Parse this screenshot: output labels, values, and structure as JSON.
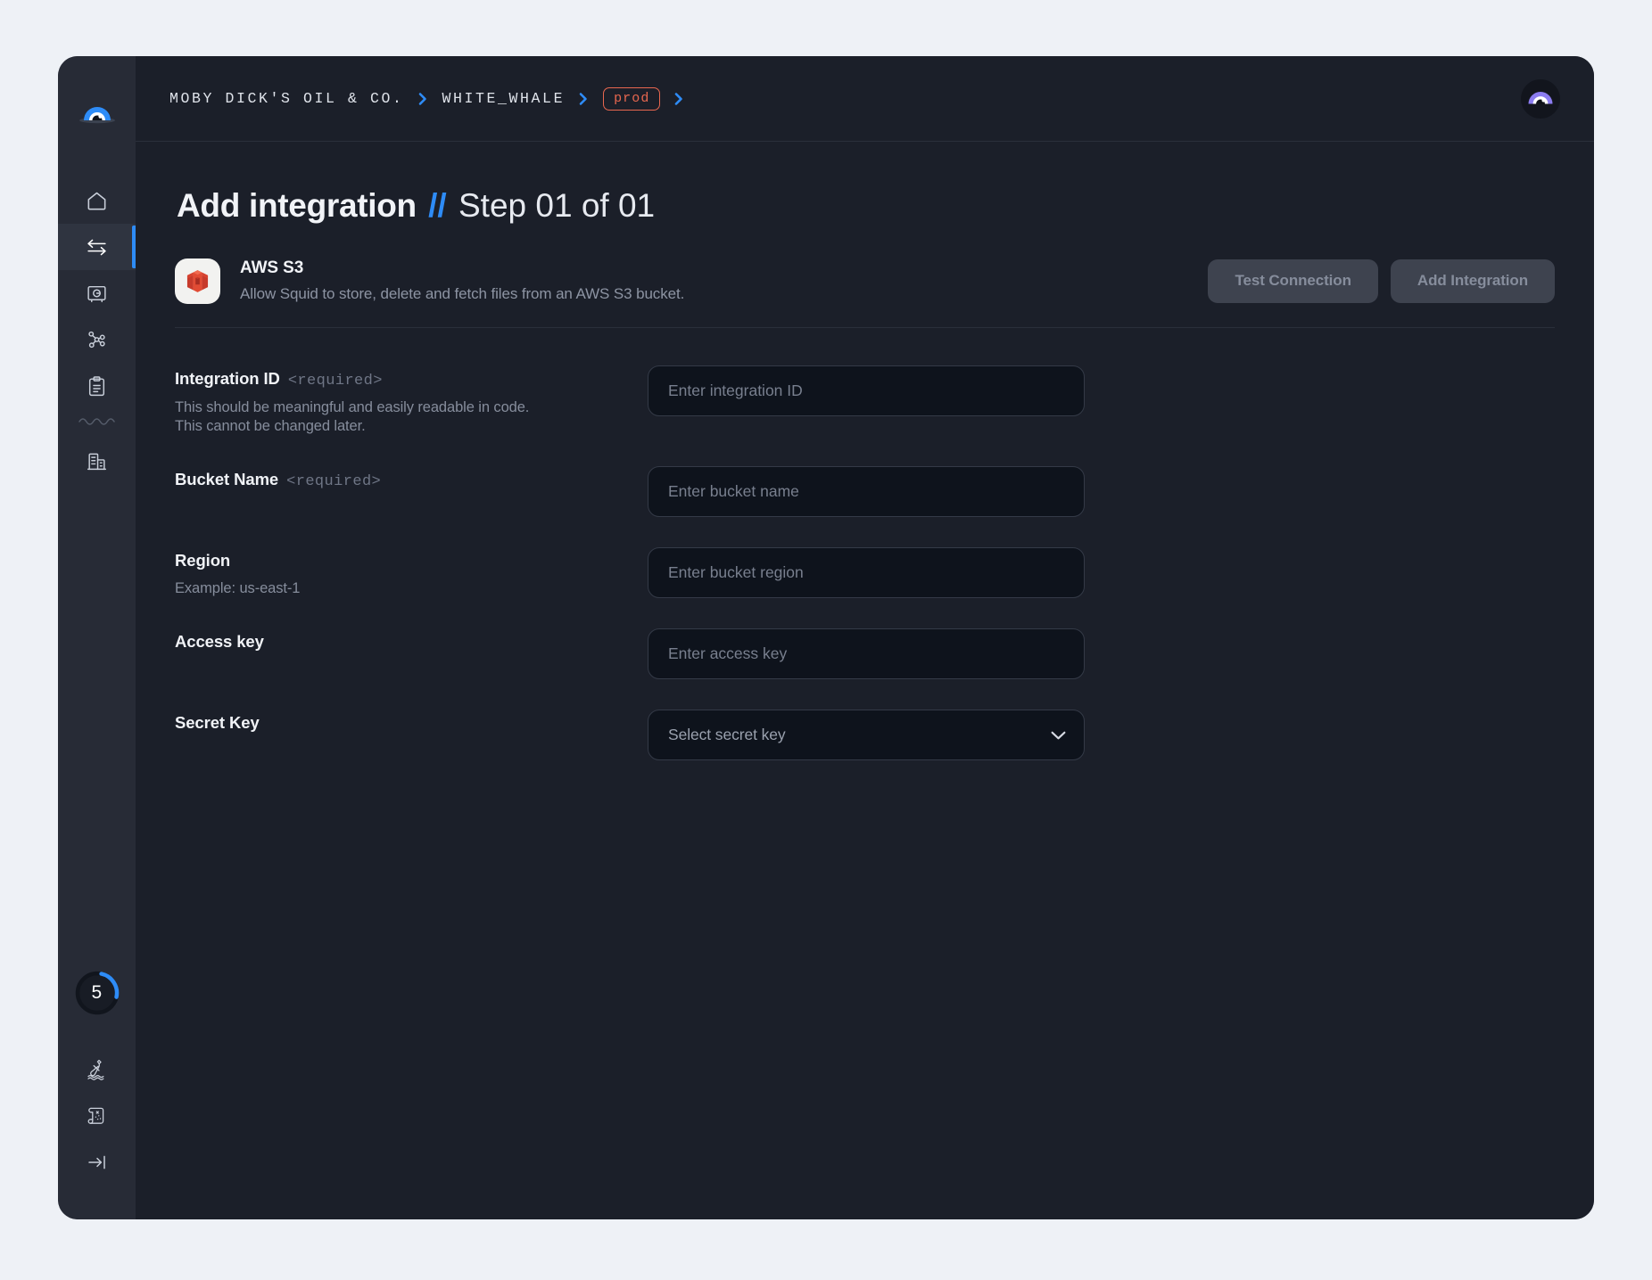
{
  "window": {
    "background_color": "#eef1f6",
    "surface_color": "#1b1f29",
    "sidebar_color": "#272b36",
    "accent_color": "#2e8cf7",
    "env_color": "#e8674f"
  },
  "sidebar": {
    "logo": {
      "name": "squid-eye-logo"
    },
    "items": [
      {
        "icon": "home-icon",
        "name": "sidebar-item-home",
        "active": false
      },
      {
        "icon": "integrations-arrows-icon",
        "name": "sidebar-item-integrations",
        "active": true
      },
      {
        "icon": "vault-safe-icon",
        "name": "sidebar-item-secrets",
        "active": false
      },
      {
        "icon": "network-graph-icon",
        "name": "sidebar-item-schema",
        "active": false
      },
      {
        "icon": "clipboard-icon",
        "name": "sidebar-item-logs",
        "active": false
      },
      {
        "icon": "wave-divider-icon",
        "name": "sidebar-divider",
        "active": false
      },
      {
        "icon": "building-icon",
        "name": "sidebar-item-organization",
        "active": false
      }
    ],
    "progress_badge": {
      "value": "5",
      "percent": 25,
      "name": "onboarding-progress"
    },
    "bottom_items": [
      {
        "icon": "message-in-bottle-icon",
        "name": "sidebar-item-feedback"
      },
      {
        "icon": "treasure-map-icon",
        "name": "sidebar-item-docs"
      },
      {
        "icon": "collapse-sidebar-icon",
        "name": "sidebar-collapse-button"
      }
    ]
  },
  "topbar": {
    "breadcrumb": [
      {
        "type": "text",
        "label": "MOBY DICK'S OIL & CO."
      },
      {
        "type": "separator",
        "label": "chevron-right-icon"
      },
      {
        "type": "text",
        "label": "WHITE_WHALE"
      },
      {
        "type": "separator",
        "label": "chevron-right-icon"
      },
      {
        "type": "badge",
        "label": "prod"
      },
      {
        "type": "separator",
        "label": "chevron-right-icon"
      }
    ],
    "avatar": {
      "name": "user-avatar"
    }
  },
  "page": {
    "title_strong": "Add integration",
    "title_separator": "//",
    "title_step": "Step 01 of 01"
  },
  "integration": {
    "logo_name": "aws-s3-logo",
    "name": "AWS S3",
    "description": "Allow Squid to store, delete and fetch files from an AWS S3 bucket.",
    "actions": [
      {
        "label": "Test Connection",
        "name": "test-connection-button"
      },
      {
        "label": "Add Integration",
        "name": "add-integration-button"
      }
    ]
  },
  "form": {
    "fields": [
      {
        "label": "Integration ID",
        "required_tag": "<required>",
        "help": "This should be meaningful and easily readable in code.\nThis cannot be changed later.",
        "control": "text",
        "placeholder": "Enter integration ID",
        "value": "",
        "name_label": "integration-id-label",
        "name_input": "integration-id-input"
      },
      {
        "label": "Bucket Name",
        "required_tag": "<required>",
        "help": "",
        "control": "text",
        "placeholder": "Enter bucket name",
        "value": "",
        "name_label": "bucket-name-label",
        "name_input": "bucket-name-input"
      },
      {
        "label": "Region",
        "required_tag": "",
        "help": "Example: us-east-1",
        "control": "text",
        "placeholder": "Enter bucket region",
        "value": "",
        "name_label": "region-label",
        "name_input": "region-input"
      },
      {
        "label": "Access key",
        "required_tag": "",
        "help": "",
        "control": "text",
        "placeholder": "Enter access key",
        "value": "",
        "name_label": "access-key-label",
        "name_input": "access-key-input"
      },
      {
        "label": "Secret Key",
        "required_tag": "",
        "help": "",
        "control": "select",
        "placeholder": "Select secret key",
        "value": "",
        "name_label": "secret-key-label",
        "name_input": "secret-key-select"
      }
    ]
  }
}
